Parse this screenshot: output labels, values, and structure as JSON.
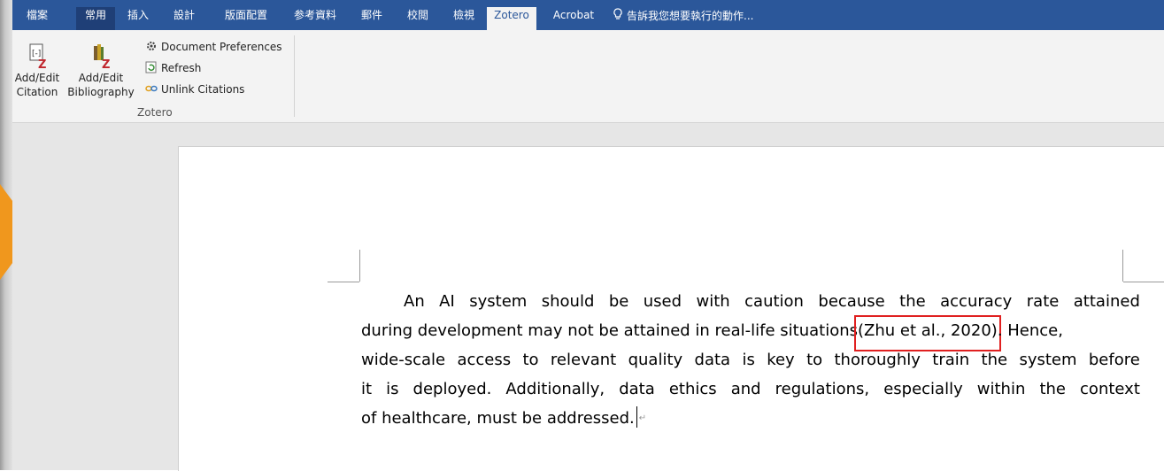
{
  "tabs": [
    "檔案",
    "常用",
    "插入",
    "設計",
    "版面配置",
    "参考資料",
    "郵件",
    "校閲",
    "檢視",
    "Zotero",
    "Acrobat"
  ],
  "tellme": "告訴我您想要執行的動作...",
  "ribbon": {
    "add_edit_citation": [
      "Add/Edit",
      "Citation"
    ],
    "add_edit_bibliography": [
      "Add/Edit",
      "Bibliography"
    ],
    "document_preferences": "Document Preferences",
    "refresh": "Refresh",
    "unlink_citations": "Unlink Citations",
    "group_label": "Zotero"
  },
  "document": {
    "line1": [
      "An",
      "AI",
      "system",
      "should",
      "be",
      "used",
      "with",
      "caution",
      "because",
      "the",
      "accuracy",
      "rate",
      "attained"
    ],
    "line2_a": "during development may not be attained in real-life situations",
    "citation": "(Zhu et al., 2020)",
    "line2_b": ". Hence,",
    "line3": [
      "wide-scale",
      "access",
      "to",
      "relevant",
      "quality",
      "data",
      "is",
      "key",
      "to",
      "thoroughly",
      "train",
      "the",
      "system",
      "before"
    ],
    "line4": [
      "it",
      "is",
      "deployed.",
      "Additionally,",
      "data",
      "ethics",
      "and",
      "regulations,",
      "especially",
      "within",
      "the",
      "context"
    ],
    "line5": "of healthcare, must be addressed.",
    "pilcrow": "↵"
  },
  "colors": {
    "accent": "#2b579a",
    "arrow": "#f0971d",
    "highlight": "#e02020"
  }
}
